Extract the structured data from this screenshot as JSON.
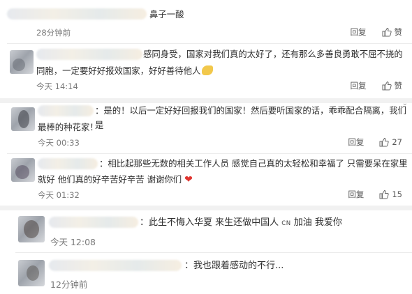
{
  "comments": [
    {
      "text": "鼻子一酸",
      "time": "28分钟前",
      "reply": "回复",
      "like": "赞"
    },
    {
      "text_line1": "感同身受，国家对我们真的太好了，还有那么多善良勇敢不屈不挠的",
      "text_line2": "同胞，一定要好好报效国家，好好善待他人",
      "time": "今天 14:14",
      "reply": "回复",
      "like": "赞"
    },
    {
      "text_line1": "：是的！以后一定好好回报我们的国家！然后要听国家的话，乖乖配合隔离，我们是",
      "text_line2": "最棒的种花家！",
      "time": "今天 00:33",
      "reply": "回复",
      "like": "27"
    },
    {
      "text_line1": "：相比起那些无数的相关工作人员 感觉自己真的太轻松和幸福了 只需要呆在家里",
      "text_line2": "就好 他们真的好辛苦好辛苦 谢谢你们",
      "time": "今天 01:32",
      "reply": "回复",
      "like": "15"
    },
    {
      "text_a": "：此生不悔入华夏 来生还做中国人",
      "text_cn": "CN",
      "text_b": "加油 我爱你",
      "time": "今天 12:08"
    },
    {
      "text": "：我也跟着感动的不行...",
      "time": "12分钟前"
    }
  ],
  "icons": {
    "thumb": "thumb-up-icon",
    "heart": "heart-emoji",
    "muscle": "flexed-biceps-emoji",
    "corner": "chevron-down-icon"
  },
  "colors": {
    "separator": "#f1f1f1",
    "heart": "#e0342f"
  }
}
